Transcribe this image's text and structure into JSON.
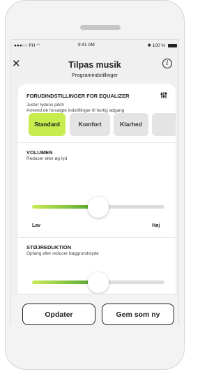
{
  "status_bar": {
    "carrier": "●●●○○ PH",
    "wifi_icon": "wifi-icon",
    "time": "9:41 AM",
    "bluetooth_icon": "bluetooth-icon",
    "battery_text": "100 %",
    "battery_level": 100
  },
  "header": {
    "close_icon": "close-icon",
    "title": "Tilpas musik",
    "subtitle": "Programindstillinger",
    "info_icon": "info-icon"
  },
  "equalizer": {
    "title": "FORUDINDSTILLINGER FOR EQUALIZER",
    "adjust_icon": "sliders-icon",
    "description_line1": "Juster lydens pitch",
    "description_line2": "Anvend de forvalgte indstillinger til hurtig adgang",
    "presets": [
      {
        "label": "Standard",
        "selected": true
      },
      {
        "label": "Komfort",
        "selected": false
      },
      {
        "label": "Klarhed",
        "selected": false
      },
      {
        "label": "",
        "selected": false
      }
    ]
  },
  "volume": {
    "title": "VOLUMEN",
    "description": "Reducer eller øg lyd",
    "level_fraction": 0.5,
    "min_label": "Lav",
    "max_label": "Høj"
  },
  "noise_reduction": {
    "title": "STØJREDUKTION",
    "description": "Opfang eller reducer baggrundslyde",
    "level_fraction": 0.5
  },
  "actions": {
    "update_label": "Opdater",
    "save_new_label": "Gem som ny"
  },
  "colors": {
    "accent_selected": "#c6ec4d",
    "slider_gradient_start": "#c9ec58",
    "slider_gradient_end": "#4aa02c"
  }
}
